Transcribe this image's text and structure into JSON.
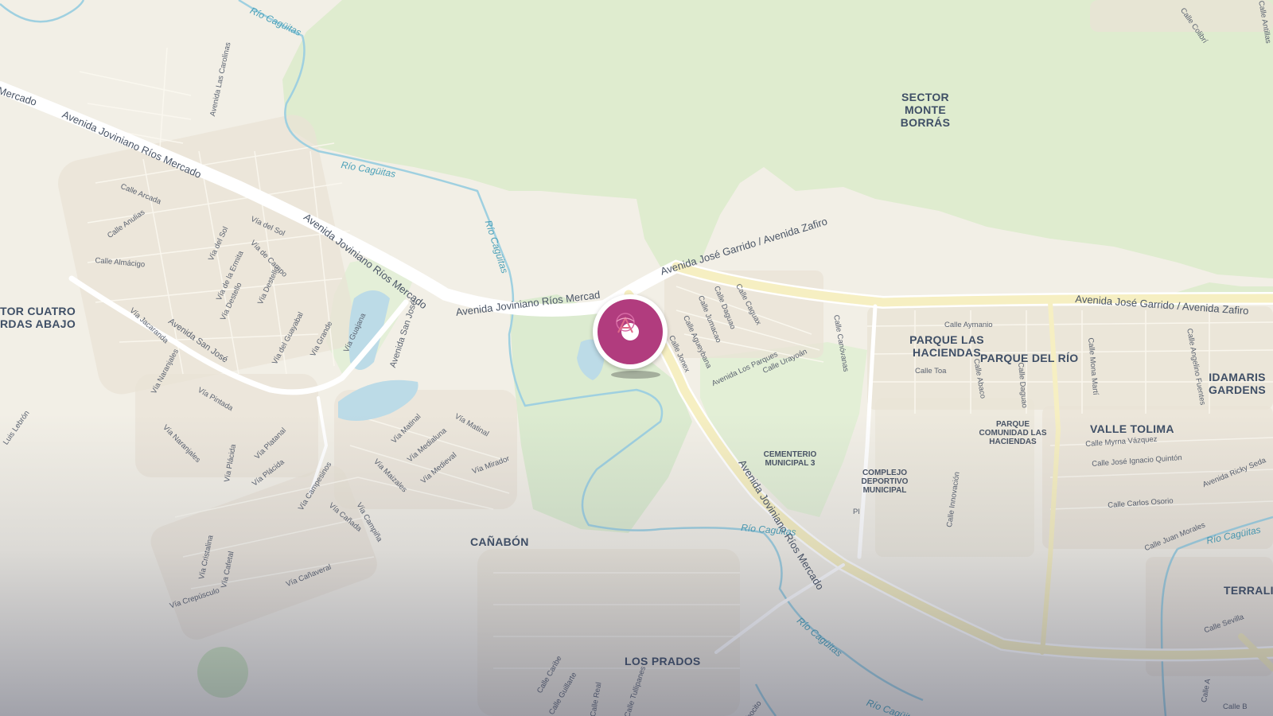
{
  "colors": {
    "marker": "#b13c7e",
    "park": "#dfeccf",
    "water": "#b9dbe8",
    "road_major": "#f6efc2",
    "land": "#f2efe6"
  },
  "marker": {
    "icon": "location-pin-icon"
  },
  "neighborhoods": {
    "sector_monte_borras": "SECTOR MONTE BORRÁS",
    "sector_cuatro": "TOR CUATRO",
    "sector_cuatro_2": "RDAS ABAJO",
    "parque_las_haciendas": "PARQUE LAS HACIENDAS",
    "parque_del_rio": "PARQUE DEL RÍO",
    "idamaris": "IDAMARIS GARDENS",
    "valle_tolima": "VALLE TOLIMA",
    "canabon": "CAÑABÓN",
    "los_prados": "LOS PRADOS",
    "terralin": "TERRALIN"
  },
  "pois": {
    "cementerio": "CEMENTERIO MUNICIPAL 3",
    "complejo": "COMPLEJO DEPORTIVO MUNICIPAL",
    "parque_comunidad": "PARQUE COMUNIDAD LAS HACIENDAS"
  },
  "roads": {
    "mercado_a": "Mercado",
    "joviniano_1": "Avenida Joviniano Ríos Mercado",
    "joviniano_2": "Avenida Joviniano Ríos Mercado",
    "joviniano_3": "Avenida Joviniano Ríos Mercad",
    "joviniano_4": "Avenida Joviniano Ríos Mercado",
    "garrido_1": "Avenida José Garrido / Avenida Zafiro",
    "garrido_2": "Avenida José Garrido / Avenida Zafiro",
    "san_jose_av": "Avenida San José",
    "san_jose_av2": "Avenida San José"
  },
  "rivers": {
    "r1": "Río Cagüitas",
    "r2": "Río Cagüitas",
    "r3": "Río Cagüitas",
    "r4": "Río Cagüitas",
    "r5": "Río Cagüitas",
    "r6": "Río Cagüitas",
    "r7": "Río Cagüitas"
  },
  "streets": {
    "las_carolinas": "Avenida Las Carolinas",
    "calle_arcada": "Calle Arcada",
    "calle_anulias": "Calle Anulias",
    "calle_almacigo": "Calle Almácigo",
    "via_del_sol": "Vía del Sol",
    "via_del_sol2": "Vía del Sol",
    "via_ermita": "Vía de la Ermita",
    "via_campo": "Vía de Campo",
    "via_destello": "Vía Destello",
    "via_destello2": "Vía Destello",
    "via_jacaranda": "Vía Jacaranda",
    "via_guayabal": "Vía del Guayabal",
    "via_grande": "Vía Grande",
    "via_guajana": "Vía Guajana",
    "via_naranjales": "Vía Naranjales",
    "via_naranjales2": "Vía Naranjales",
    "via_pintada": "Vía Pintada",
    "via_placida": "Vía Plácida",
    "via_placida2": "Vía Plácida",
    "via_platanal": "Vía Platanal",
    "via_matinal": "Vía Matinal",
    "via_matinal2": "Vía Matinal",
    "via_medialuna": "Vía Medialuna",
    "via_maizales": "Vía Maizales",
    "via_medieval": "Vía Medieval",
    "via_mirador": "Vía Mirador",
    "via_campesinos": "Vía Campesinos",
    "via_canada": "Vía Cañada",
    "via_campina": "Vía Campiña",
    "via_cristalina": "Vía Cristalina",
    "via_cafetal": "Vía Cafetal",
    "via_crepusculo": "Vía Crepúsculo",
    "via_canaveral": "Vía Cañaveral",
    "luis_lebron": "Luis Lebrón",
    "calle_daguao": "Calle Daguao",
    "calle_jumacao": "Calle Jumacao",
    "calle_caguax": "Calle Caguax",
    "calle_agueybana": "Calle Agueybana",
    "calle_jonex": "Calle Jonex",
    "av_los_parques": "Avenida Los Parques",
    "calle_urayoan": "Calle Urayoán",
    "calle_canovanas": "Calle Canóvanas",
    "calle_aymanio": "Calle Aymanio",
    "calle_toa": "Calle Toa",
    "calle_abaco": "Calle Abaco",
    "calle_daguao2": "Calle Daguao",
    "calle_mona_marti": "Calle Mona Martí",
    "calle_angelino": "Calle Angelino Fuentes",
    "calle_myrna": "Calle Myrna Vázquez",
    "calle_jose_ignacio": "Calle José Ignacio Quintón",
    "av_ricky_seda": "Avenida Ricky Seda",
    "calle_carlos_osorio": "Calle Carlos Osorio",
    "calle_juan_morales": "Calle Juan Morales",
    "calle_innovacion": "Calle Innovación",
    "calle_sevilla": "Calle Sevilla",
    "calle_colibri": "Calle Colibrí",
    "calle_antillas": "Calle Antillas",
    "calle_caribe": "Calle Caribe",
    "calle_guillarte": "Calle Guillarte",
    "calle_tullipanes": "Calle Tullipanes",
    "calle_real": "Calle Real",
    "calle_a": "Calle A",
    "calle_b": "Calle B",
    "pl": "Pl",
    "abajo_cito": "bocito"
  }
}
